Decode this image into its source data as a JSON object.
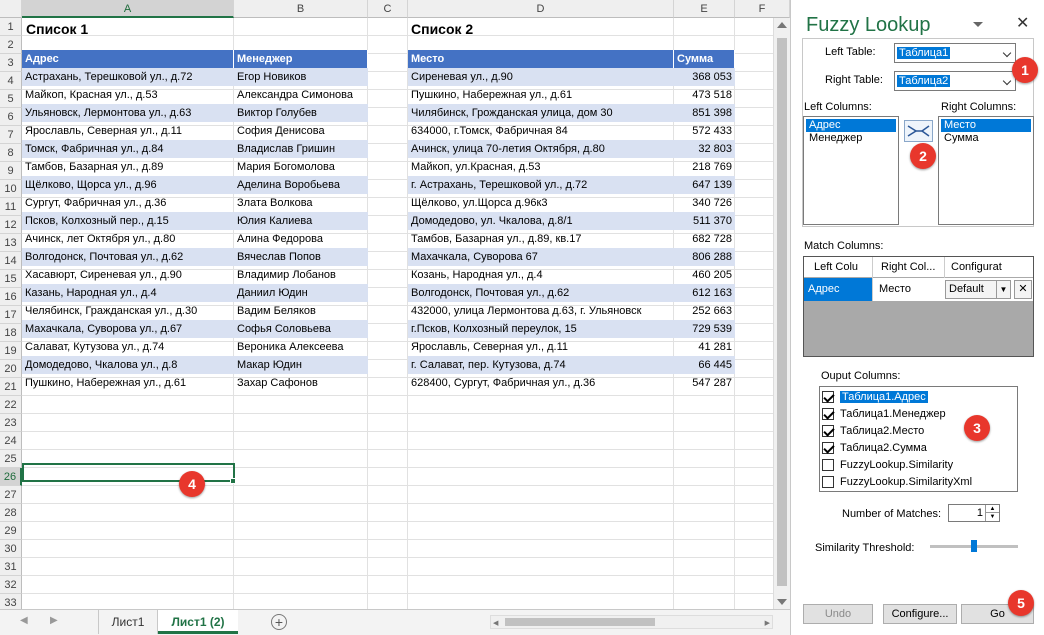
{
  "sheet": {
    "columns": [
      "A",
      "B",
      "C",
      "D",
      "E",
      "F"
    ],
    "rows": [
      "1",
      "2",
      "3",
      "4",
      "5",
      "6",
      "7",
      "8",
      "9",
      "10",
      "11",
      "12",
      "13",
      "14",
      "15",
      "16",
      "17",
      "18",
      "19",
      "20",
      "21",
      "22",
      "23",
      "24",
      "25",
      "26",
      "27",
      "28",
      "29",
      "30",
      "31",
      "32",
      "33"
    ],
    "list1_title": "Список 1",
    "list2_title": "Список 2",
    "table1": {
      "headers": [
        "Адрес",
        "Менеджер"
      ],
      "rows": [
        [
          "Астрахань, Терешковой ул., д.72",
          "Егор Новиков"
        ],
        [
          "Майкоп, Красная ул., д.53",
          "Александра Симонова"
        ],
        [
          "Ульяновск, Лермонтова ул., д.63",
          "Виктор Голубев"
        ],
        [
          "Ярославль, Северная ул., д.11",
          "София Денисова"
        ],
        [
          "Томск, Фабричная ул., д.84",
          "Владислав Гришин"
        ],
        [
          "Тамбов, Базарная ул., д.89",
          "Мария Богомолова"
        ],
        [
          "Щёлково, Щорса ул., д.96",
          "Аделина Воробьева"
        ],
        [
          "Сургут, Фабричная ул., д.36",
          "Злата Волкова"
        ],
        [
          "Псков, Колхозный пер., д.15",
          "Юлия Калиева"
        ],
        [
          "Ачинск, лет Октября ул., д.80",
          "Алина Федорова"
        ],
        [
          "Волгодонск, Почтовая ул., д.62",
          "Вячеслав Попов"
        ],
        [
          "Хасавюрт, Сиреневая ул., д.90",
          "Владимир Лобанов"
        ],
        [
          "Казань, Народная ул., д.4",
          "Даниил Юдин"
        ],
        [
          "Челябинск, Гражданская ул., д.30",
          "Вадим Беляков"
        ],
        [
          "Махачкала, Суворова ул., д.67",
          "Софья Соловьева"
        ],
        [
          "Салават, Кутузова ул., д.74",
          "Вероника Алексеева"
        ],
        [
          "Домодедово, Чкалова ул., д.8",
          "Макар Юдин"
        ],
        [
          "Пушкино, Набережная ул., д.61",
          "Захар Сафонов"
        ]
      ]
    },
    "table2": {
      "headers": [
        "Место",
        "Сумма"
      ],
      "rows": [
        [
          "Сиреневая ул., д.90",
          "368 053"
        ],
        [
          "Пушкино, Набережная ул., д.61",
          "473 518"
        ],
        [
          "Чилябинск, Грожданская улица, дом 30",
          "851 398"
        ],
        [
          "634000, г.Томск, Фабричная 84",
          "572 433"
        ],
        [
          "Ачинск, улица 70-летия Октября, д.80",
          "32 803"
        ],
        [
          "Майкоп, ул.Красная, д.53",
          "218 769"
        ],
        [
          "г. Астрахань, Терешковой ул., д.72",
          "647 139"
        ],
        [
          "Щёлково, ул.Щорса д.96к3",
          "340 726"
        ],
        [
          "Домодедово, ул. Чкалова, д.8/1",
          "511 370"
        ],
        [
          "Тамбов, Базарная ул., д.89, кв.17",
          "682 728"
        ],
        [
          "Махачкала, Суворова 67",
          "806 288"
        ],
        [
          "Козань, Народная ул., д.4",
          "460 205"
        ],
        [
          "Волгодонск, Почтовая ул., д.62",
          "612 163"
        ],
        [
          "432000, улица Лермонтова д.63, г. Ульяновск",
          "252 663"
        ],
        [
          "г.Псков, Колхозный переулок, 15",
          "729 539"
        ],
        [
          "Ярославль, Северная ул., д.11",
          "41 281"
        ],
        [
          "г. Салават, пер. Кутузова, д.74",
          "66 445"
        ],
        [
          "628400, Сургут, Фабричная ул., д.36",
          "547 287"
        ]
      ]
    },
    "tabs": [
      "Лист1",
      "Лист1 (2)"
    ],
    "active_tab": "Лист1 (2)"
  },
  "panel": {
    "title": "Fuzzy Lookup",
    "left_table_label": "Left Table:",
    "left_table_value": "Таблица1",
    "right_table_label": "Right Table:",
    "right_table_value": "Таблица2",
    "left_columns_label": "Left Columns:",
    "right_columns_label": "Right Columns:",
    "left_columns": [
      "Адрес",
      "Менеджер"
    ],
    "right_columns": [
      "Место",
      "Сумма"
    ],
    "match_columns_label": "Match Columns:",
    "match_headers": [
      "Left Colu",
      "Right Col...",
      "Configurat"
    ],
    "match_row": [
      "Адрес",
      "Место",
      "Default"
    ],
    "output_columns_label": "Ouput Columns:",
    "output_columns": [
      {
        "label": "Таблица1.Адрес",
        "checked": true
      },
      {
        "label": "Таблица1.Менеджер",
        "checked": true
      },
      {
        "label": "Таблица2.Место",
        "checked": true
      },
      {
        "label": "Таблица2.Сумма",
        "checked": true
      },
      {
        "label": "FuzzyLookup.Similarity",
        "checked": false
      },
      {
        "label": "FuzzyLookup.SimilarityXml",
        "checked": false
      }
    ],
    "num_matches_label": "Number of Matches:",
    "num_matches_value": "1",
    "similarity_label": "Similarity Threshold:",
    "undo_label": "Undo",
    "configure_label": "Configure...",
    "go_label": "Go"
  },
  "badges": [
    "1",
    "2",
    "3",
    "4",
    "5"
  ],
  "colors": {
    "accent": "#217346",
    "table_header": "#4472c4",
    "band": "#d9e1f2",
    "badge": "#e8372c",
    "selection": "#0078d7"
  }
}
